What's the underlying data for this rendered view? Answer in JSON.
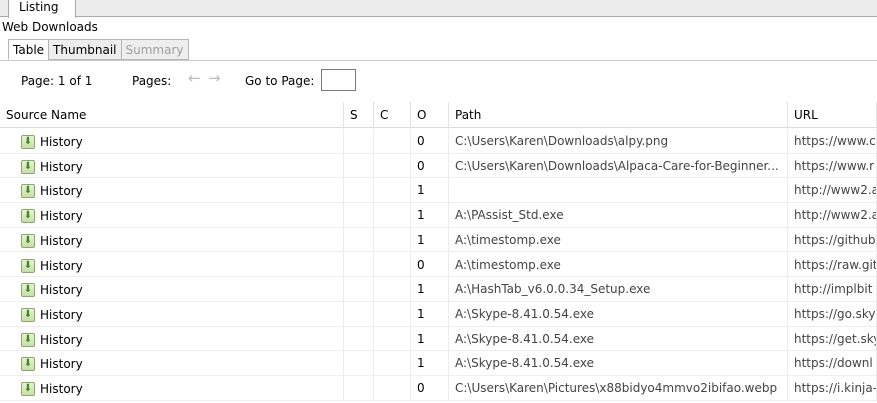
{
  "top_tab": {
    "label": "Listing"
  },
  "panel": {
    "title": "Web Downloads"
  },
  "subtabs": [
    "Table",
    "Thumbnail",
    "Summary"
  ],
  "pager": {
    "page_label": "Page:  1 of 1",
    "pages_label": "Pages:",
    "prev_glyph": "←",
    "next_glyph": "→",
    "goto_label": "Go to Page:",
    "goto_value": ""
  },
  "columns": [
    "Source Name",
    "S",
    "C",
    "O",
    "Path",
    "URL"
  ],
  "rows": [
    {
      "source": "History",
      "s": "",
      "c": "",
      "o": "0",
      "path": "C:\\Users\\Karen\\Downloads\\alpy.png",
      "url": "https://www.c"
    },
    {
      "source": "History",
      "s": "",
      "c": "",
      "o": "0",
      "path": "C:\\Users\\Karen\\Downloads\\Alpaca-Care-for-Beginner...",
      "url": "https://www.r"
    },
    {
      "source": "History",
      "s": "",
      "c": "",
      "o": "1",
      "path": "",
      "url": "http://www2.a"
    },
    {
      "source": "History",
      "s": "",
      "c": "",
      "o": "1",
      "path": "A:\\PAssist_Std.exe",
      "url": "http://www2.a"
    },
    {
      "source": "History",
      "s": "",
      "c": "",
      "o": "1",
      "path": "A:\\timestomp.exe",
      "url": "https://github"
    },
    {
      "source": "History",
      "s": "",
      "c": "",
      "o": "0",
      "path": "A:\\timestomp.exe",
      "url": "https://raw.git"
    },
    {
      "source": "History",
      "s": "",
      "c": "",
      "o": "1",
      "path": "A:\\HashTab_v6.0.0.34_Setup.exe",
      "url": "http://implbit"
    },
    {
      "source": "History",
      "s": "",
      "c": "",
      "o": "1",
      "path": "A:\\Skype-8.41.0.54.exe",
      "url": "https://go.sky"
    },
    {
      "source": "History",
      "s": "",
      "c": "",
      "o": "1",
      "path": "A:\\Skype-8.41.0.54.exe",
      "url": "https://get.sky"
    },
    {
      "source": "History",
      "s": "",
      "c": "",
      "o": "1",
      "path": "A:\\Skype-8.41.0.54.exe",
      "url": "https://downl"
    },
    {
      "source": "History",
      "s": "",
      "c": "",
      "o": "0",
      "path": "C:\\Users\\Karen\\Pictures\\x88bidyo4mmvo2ibifao.webp",
      "url": "https://i.kinja-"
    }
  ],
  "icons": {
    "download": "download-arrow-icon"
  },
  "colors": {
    "tab_bg": "#ececec",
    "icon_green": "#3f8a1f",
    "border": "#a9a9a9"
  }
}
